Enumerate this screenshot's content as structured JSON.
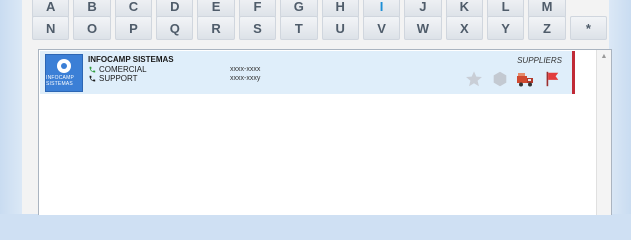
{
  "alphabet": {
    "row1": [
      "A",
      "B",
      "C",
      "D",
      "E",
      "F",
      "G",
      "H",
      "I",
      "J",
      "K",
      "L",
      "M"
    ],
    "row2": [
      "N",
      "O",
      "P",
      "Q",
      "R",
      "S",
      "T",
      "U",
      "V",
      "W",
      "X",
      "Y",
      "Z",
      "*"
    ],
    "active_letter": "I"
  },
  "record": {
    "company": "INFOCAMP SISTEMAS",
    "category": "SUPPLIERS",
    "logo_text": "INFOCAMP SISTEMAS",
    "contacts": [
      {
        "label": "COMERCIAL",
        "number": "xxxx-xxxx"
      },
      {
        "label": "SUPPORT",
        "number": "xxxx-xxxy"
      }
    ],
    "actions": [
      "star-icon",
      "hexagon-icon",
      "truck-icon",
      "flag-icon"
    ]
  },
  "colors": {
    "accent_bar": "#c02a36",
    "record_bg": "#dfeefa",
    "active_letter": "#1d8fd6",
    "phone": "#2e9b3c"
  }
}
